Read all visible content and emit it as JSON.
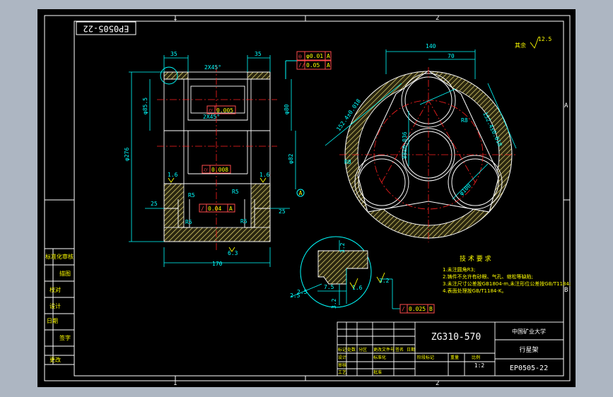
{
  "drawing": {
    "code_stamp": "EP0505-22",
    "material": "ZG310-570",
    "part_name": "行星架",
    "drawing_no": "EP0505-22",
    "scale": "1:2",
    "title_block_header": "中国矿业大学",
    "zone_labels": {
      "top_1": "1",
      "top_2": "2",
      "bottom_1": "1",
      "bottom_2": "2",
      "right_a": "A",
      "right_b": "B"
    },
    "roughness_other": "12.5",
    "roughness_other_label": "其余"
  },
  "section_view": {
    "dims": [
      "35",
      "35",
      "2X45°",
      "2X45°",
      "φ276",
      "φ85.5",
      "φ80",
      "φ82",
      "25",
      "25",
      "170",
      "R5",
      "R5",
      "R5",
      "R5",
      "1.6",
      "1.6",
      "6.3"
    ],
    "fcf": [
      {
        "sym": "◎",
        "tol": "φ0.01",
        "ref": "A"
      },
      {
        "sym": "//",
        "tol": "0.05",
        "ref": "A"
      },
      {
        "sym": "⌭",
        "tol": "0.005",
        "ref": ""
      },
      {
        "sym": "⌭",
        "tol": "0.008",
        "ref": ""
      },
      {
        "sym": "/",
        "tol": "0.04",
        "ref": "A"
      }
    ],
    "datum": "A"
  },
  "plan_view": {
    "dims": [
      "140",
      "70",
      "152.4±0.018",
      "152.4±0.018",
      "88±0.036",
      "R8",
      "R8",
      "φ100"
    ]
  },
  "detail_view": {
    "dims": [
      "3.2",
      "7.5",
      "1.6",
      "3.2",
      "2.5",
      "3.2",
      "2.5"
    ],
    "fcf": {
      "sym": "/",
      "tol": "0.025",
      "ref": "B"
    }
  },
  "tech_req": {
    "title": "技 术 要 求",
    "lines": [
      "1.未注圆角R3;",
      "2.铸件不允许有砂眼、气孔、缩松等缺陷;",
      "3.未注尺寸公差按GB1804-m,未注形位公差按GB/T1184;",
      "4.表面处理按GB/T1184-K。"
    ]
  },
  "left_table": [
    "标准化审核",
    "描图",
    "校对",
    "设计",
    "日期",
    "签字",
    "更改"
  ],
  "title_block_cells": [
    "标记",
    "处数",
    "分区",
    "更改文件号",
    "签名",
    "日期",
    "设计",
    "标准化",
    "阶段标记",
    "重量",
    "比例",
    "审核",
    "工艺",
    "批准"
  ],
  "colors": {
    "background": "#000000",
    "frame": "#ffffff",
    "geometry": "#ffffff",
    "dimension": "#00ffff",
    "hatch": "#d9cc6a",
    "center": "#ff2020",
    "annotation": "#ffff00",
    "fcf": "#ff4b4b"
  }
}
